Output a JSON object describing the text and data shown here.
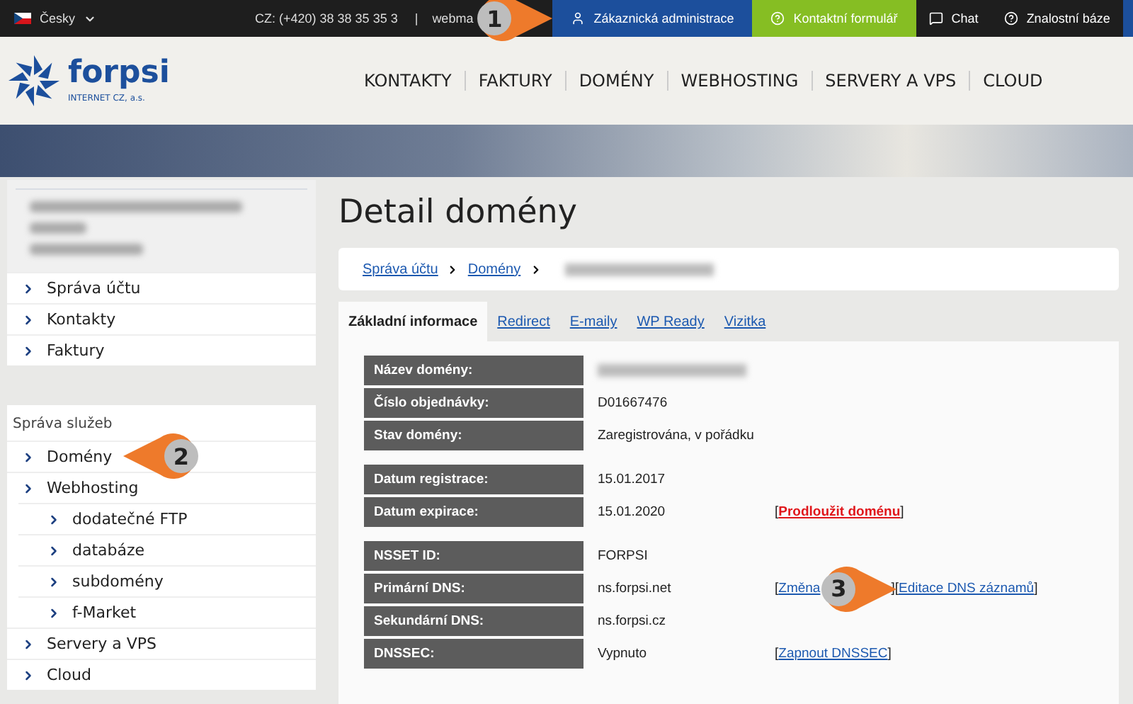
{
  "top_bar": {
    "language": "Česky",
    "phone": "CZ: (+420) 38 38 35 35 3",
    "separator": "|",
    "webmail": "webma",
    "callout": {
      "number": "1",
      "kind": "arrow_right"
    },
    "buttons": [
      {
        "label": "Zákaznická administrace",
        "kind": "admin"
      },
      {
        "label": "Kontaktní formulář",
        "kind": "contact"
      },
      {
        "label": "Chat",
        "kind": "chat"
      },
      {
        "label": "Znalostní báze",
        "kind": "help"
      },
      {
        "kind": "logout"
      }
    ]
  },
  "header": {
    "logo": "forpsi",
    "logo_subtitle": "INTERNET CZ, a.s.",
    "nav": [
      "KONTAKTY",
      "FAKTURY",
      "DOMÉNY",
      "WEBHOSTING",
      "SERVERY A VPS",
      "CLOUD"
    ]
  },
  "sidebar": {
    "account_items": [
      {
        "label": "Správa účtu"
      },
      {
        "label": "Kontakty"
      },
      {
        "label": "Faktury"
      }
    ],
    "services_heading": "Správa služeb",
    "service_items": [
      {
        "label": "Domény",
        "callout": {
          "number": "2",
          "kind": "arrow_left"
        }
      },
      {
        "label": "Webhosting",
        "children": [
          {
            "label": "dodatečné FTP"
          },
          {
            "label": "databáze"
          },
          {
            "label": "subdomény"
          },
          {
            "label": "f-Market"
          }
        ]
      },
      {
        "label": "Servery a VPS"
      },
      {
        "label": "Cloud"
      }
    ]
  },
  "content": {
    "title": "Detail domény",
    "breadcrumb": [
      "Správa účtu",
      "Domény"
    ],
    "tabs": [
      {
        "label": "Základní informace",
        "selected": true
      },
      {
        "label": "Redirect",
        "selected": false
      },
      {
        "label": "E-maily",
        "selected": false
      },
      {
        "label": "WP Ready",
        "selected": false
      },
      {
        "label": "Vizitka",
        "selected": false
      }
    ],
    "groups": [
      {
        "rows": [
          {
            "label": "Název domény:",
            "value_blurred": true
          },
          {
            "label": "Číslo objednávky:",
            "value": "D01667476"
          },
          {
            "label": "Stav domény:",
            "value": "Zaregistrována, v pořádku"
          }
        ]
      },
      {
        "rows": [
          {
            "label": "Datum registrace:",
            "value": "15.01.2017"
          },
          {
            "label": "Datum expirace:",
            "value": "15.01.2020",
            "actions": [
              {
                "label": "Prodloužit doménu",
                "kind": "danger"
              }
            ]
          }
        ]
      },
      {
        "rows": [
          {
            "label": "NSSET ID:",
            "value": "FORPSI"
          },
          {
            "label": "Primární DNS:",
            "value": "ns.forpsi.net",
            "actions": [
              {
                "label": "Změna",
                "kind": "link",
                "callout": {
                  "number": "3",
                  "kind": "arrow_right"
                }
              },
              {
                "label": "Editace DNS záznamů",
                "kind": "link"
              }
            ]
          },
          {
            "label": "Sekundární DNS:",
            "value": "ns.forpsi.cz"
          },
          {
            "label": "DNSSEC:",
            "value": "Vypnuto",
            "actions": [
              {
                "label": "Zapnout DNSSEC",
                "kind": "link"
              }
            ]
          }
        ]
      }
    ]
  },
  "bracket_open": "[",
  "bracket_close": "]"
}
